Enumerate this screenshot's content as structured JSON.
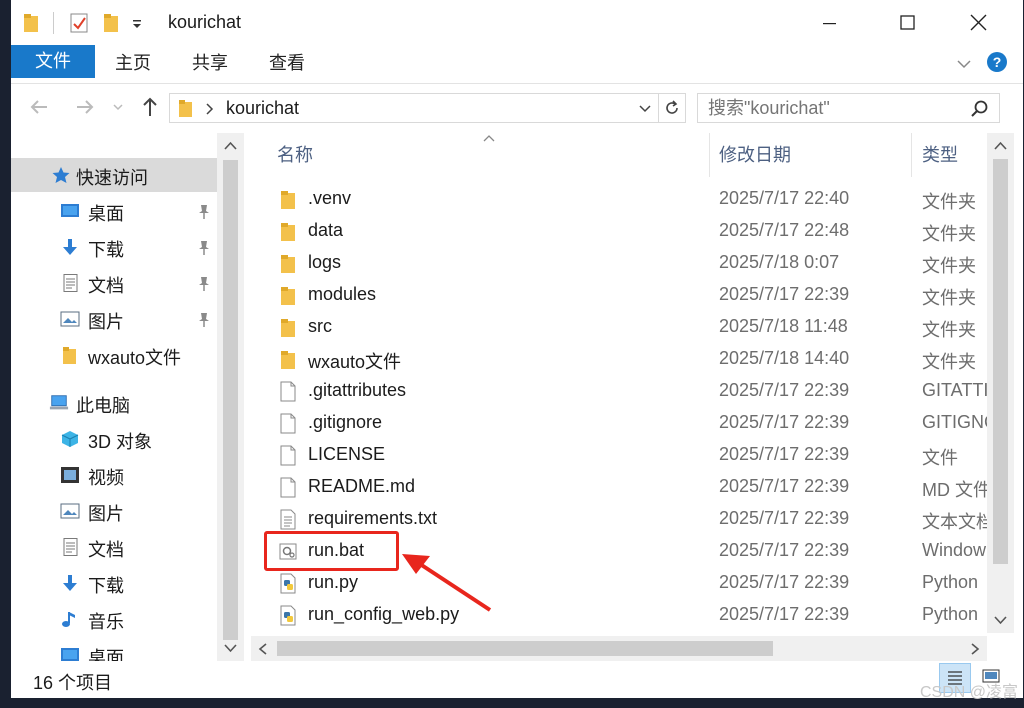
{
  "window": {
    "title": "kourichat"
  },
  "ribbon": {
    "tabs": [
      "文件",
      "主页",
      "共享",
      "查看"
    ]
  },
  "address": {
    "path": "kourichat",
    "search_placeholder": "搜索\"kourichat\""
  },
  "nav": {
    "quick_access": "快速访问",
    "items": [
      {
        "label": "桌面",
        "icon": "desktop-icon",
        "pinned": true
      },
      {
        "label": "下载",
        "icon": "download-icon",
        "pinned": true
      },
      {
        "label": "文档",
        "icon": "document-icon",
        "pinned": true
      },
      {
        "label": "图片",
        "icon": "picture-icon",
        "pinned": true
      },
      {
        "label": "wxauto文件",
        "icon": "folder-icon",
        "pinned": false
      }
    ],
    "this_pc": "此电脑",
    "pc_items": [
      {
        "label": "3D 对象",
        "icon": "3d-objects-icon"
      },
      {
        "label": "视频",
        "icon": "video-icon"
      },
      {
        "label": "图片",
        "icon": "picture-icon"
      },
      {
        "label": "文档",
        "icon": "document-icon"
      },
      {
        "label": "下载",
        "icon": "download-icon"
      },
      {
        "label": "音乐",
        "icon": "music-icon"
      },
      {
        "label": "桌面",
        "icon": "desktop-icon"
      }
    ]
  },
  "columns": {
    "name": "名称",
    "date": "修改日期",
    "type": "类型"
  },
  "files": [
    {
      "name": ".venv",
      "date": "2025/7/17 22:40",
      "type": "文件夹",
      "icon": "folder"
    },
    {
      "name": "data",
      "date": "2025/7/17 22:48",
      "type": "文件夹",
      "icon": "folder"
    },
    {
      "name": "logs",
      "date": "2025/7/18 0:07",
      "type": "文件夹",
      "icon": "folder"
    },
    {
      "name": "modules",
      "date": "2025/7/17 22:39",
      "type": "文件夹",
      "icon": "folder"
    },
    {
      "name": "src",
      "date": "2025/7/18 11:48",
      "type": "文件夹",
      "icon": "folder"
    },
    {
      "name": "wxauto文件",
      "date": "2025/7/18 14:40",
      "type": "文件夹",
      "icon": "folder"
    },
    {
      "name": ".gitattributes",
      "date": "2025/7/17 22:39",
      "type": "GITATTI",
      "icon": "file"
    },
    {
      "name": ".gitignore",
      "date": "2025/7/17 22:39",
      "type": "GITIGNC",
      "icon": "file"
    },
    {
      "name": "LICENSE",
      "date": "2025/7/17 22:39",
      "type": "文件",
      "icon": "file"
    },
    {
      "name": "README.md",
      "date": "2025/7/17 22:39",
      "type": "MD 文件",
      "icon": "file"
    },
    {
      "name": "requirements.txt",
      "date": "2025/7/17 22:39",
      "type": "文本文档",
      "icon": "text"
    },
    {
      "name": "run.bat",
      "date": "2025/7/17 22:39",
      "type": "Window",
      "icon": "bat"
    },
    {
      "name": "run.py",
      "date": "2025/7/17 22:39",
      "type": "Python",
      "icon": "python"
    },
    {
      "name": "run_config_web.py",
      "date": "2025/7/17 22:39",
      "type": "Python",
      "icon": "python"
    }
  ],
  "status": {
    "item_count": "16 个项目"
  },
  "watermark": "CSDN @凌富",
  "colors": {
    "accent": "#1979ca",
    "folder": "#f3c14b",
    "highlight": "#e8261d"
  }
}
